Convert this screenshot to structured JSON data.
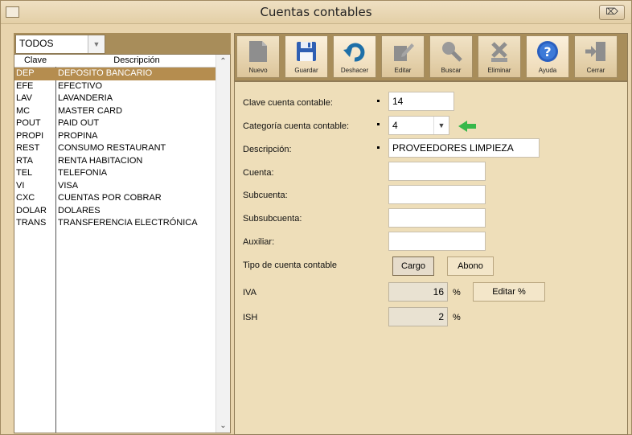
{
  "window": {
    "title": "Cuentas contables",
    "close_label": "⌦"
  },
  "filter": {
    "value": "TODOS"
  },
  "list": {
    "headers": {
      "clave": "Clave",
      "descripcion": "Descripción"
    },
    "rows": [
      {
        "clave": "DEP",
        "descripcion": "DEPOSITO BANCARIO",
        "selected": true
      },
      {
        "clave": "EFE",
        "descripcion": "EFECTIVO"
      },
      {
        "clave": "LAV",
        "descripcion": "LAVANDERIA"
      },
      {
        "clave": "MC",
        "descripcion": "MASTER CARD"
      },
      {
        "clave": "POUT",
        "descripcion": "PAID OUT"
      },
      {
        "clave": "PROPI",
        "descripcion": "PROPINA"
      },
      {
        "clave": "REST",
        "descripcion": "CONSUMO RESTAURANT"
      },
      {
        "clave": "RTA",
        "descripcion": "RENTA HABITACION"
      },
      {
        "clave": "TEL",
        "descripcion": "TELEFONIA"
      },
      {
        "clave": "VI",
        "descripcion": "VISA"
      },
      {
        "clave": "CXC",
        "descripcion": "CUENTAS POR COBRAR"
      },
      {
        "clave": "DOLAR",
        "descripcion": "DOLARES"
      },
      {
        "clave": "TRANS",
        "descripcion": "TRANSFERENCIA ELECTRÓNICA"
      }
    ]
  },
  "toolbar": {
    "nuevo": "Nuevo",
    "guardar": "Guardar",
    "deshacer": "Deshacer",
    "editar": "Editar",
    "buscar": "Buscar",
    "eliminar": "Eliminar",
    "ayuda": "Ayuda",
    "cerrar": "Cerrar"
  },
  "form": {
    "clave_label": "Clave cuenta contable:",
    "clave_value": "14",
    "categoria_label": "Categoría cuenta contable:",
    "categoria_value": "4",
    "descripcion_label": "Descripción:",
    "descripcion_value": "PROVEEDORES LIMPIEZA",
    "cuenta_label": "Cuenta:",
    "cuenta_value": "",
    "subcuenta_label": "Subcuenta:",
    "subcuenta_value": "",
    "subsubcuenta_label": "Subsubcuenta:",
    "subsubcuenta_value": "",
    "auxiliar_label": "Auxiliar:",
    "auxiliar_value": "",
    "tipo_label": "Tipo de cuenta contable",
    "cargo_label": "Cargo",
    "abono_label": "Abono",
    "iva_label": "IVA",
    "iva_value": "16",
    "ish_label": "ISH",
    "ish_value": "2",
    "percent_sign": "%",
    "editar_pct_label": "Editar %"
  },
  "colors": {
    "selected_row": "#b58d4f",
    "toolbar_bg": "#a88d5a",
    "form_bg": "#eedeb9"
  }
}
